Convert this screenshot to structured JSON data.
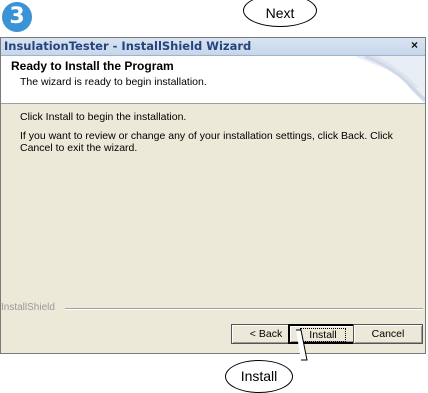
{
  "step_number": "3",
  "callouts": {
    "next": "Next",
    "install": "Install"
  },
  "window": {
    "title": "InsulationTester - InstallShield Wizard",
    "close_glyph": "×"
  },
  "header": {
    "title": "Ready to Install the Program",
    "subtitle": "The wizard is ready to begin installation."
  },
  "content": {
    "line1": "Click Install to begin the installation.",
    "line2": "If you want to review or change any of your installation settings, click Back. Click Cancel to exit the wizard."
  },
  "footer": {
    "brand": "InstallShield"
  },
  "buttons": {
    "back": "< Back",
    "install": "Install",
    "cancel": "Cancel"
  },
  "colors": {
    "badge": "#3a93d6",
    "title_text": "#26457e",
    "dialog_bg": "#ece9d8"
  },
  "icons": {
    "close": "close-icon",
    "corner": "wizard-corner-graphic"
  }
}
